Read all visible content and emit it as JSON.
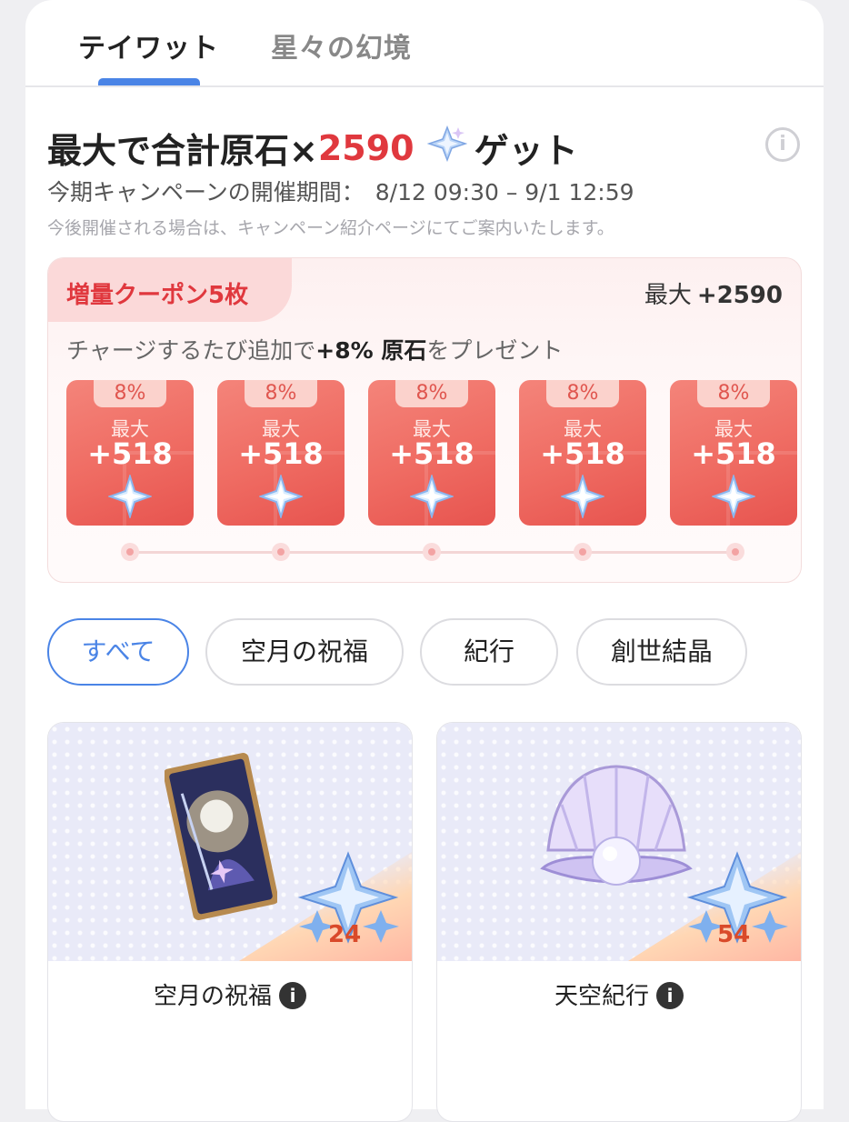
{
  "tabs": [
    {
      "label": "テイワット",
      "active": true
    },
    {
      "label": "星々の幻境",
      "active": false
    }
  ],
  "campaign": {
    "headline_prefix": "最大で合計原石×",
    "headline_amount": "2590",
    "headline_suffix": "ゲット",
    "period_label": "今期キャンペーンの開催期間：",
    "period_dates": "8/12 09:30 – 9/1 12:59",
    "note": "今後開催される場合は、キャンペーン紹介ページにてご案内いたします。",
    "info_icon": "info-circle-icon"
  },
  "coupon_panel": {
    "tag": "増量クーポン5枚",
    "max_word": "最大",
    "max_value": "+2590",
    "charge_prefix": "チャージするたび追加で",
    "charge_bold": "+8% 原石",
    "charge_suffix": "をプレゼント",
    "coupons": [
      {
        "percent": "8%",
        "max_word": "最大",
        "value": "+518"
      },
      {
        "percent": "8%",
        "max_word": "最大",
        "value": "+518"
      },
      {
        "percent": "8%",
        "max_word": "最大",
        "value": "+518"
      },
      {
        "percent": "8%",
        "max_word": "最大",
        "value": "+518"
      },
      {
        "percent": "8%",
        "max_word": "最大",
        "value": "+518"
      }
    ]
  },
  "filters": [
    {
      "label": "すべて",
      "active": true
    },
    {
      "label": "空月の祝福",
      "active": false
    },
    {
      "label": "紀行",
      "active": false
    },
    {
      "label": "創世結晶",
      "active": false
    }
  ],
  "products": [
    {
      "title": "空月の祝福",
      "count": "24",
      "art": "blessing-card"
    },
    {
      "title": "天空紀行",
      "count": "54",
      "art": "pearl-shell"
    }
  ],
  "colors": {
    "accent_blue": "#4a84e6",
    "accent_red": "#e0383e",
    "coupon_red": "#ef6b62"
  }
}
